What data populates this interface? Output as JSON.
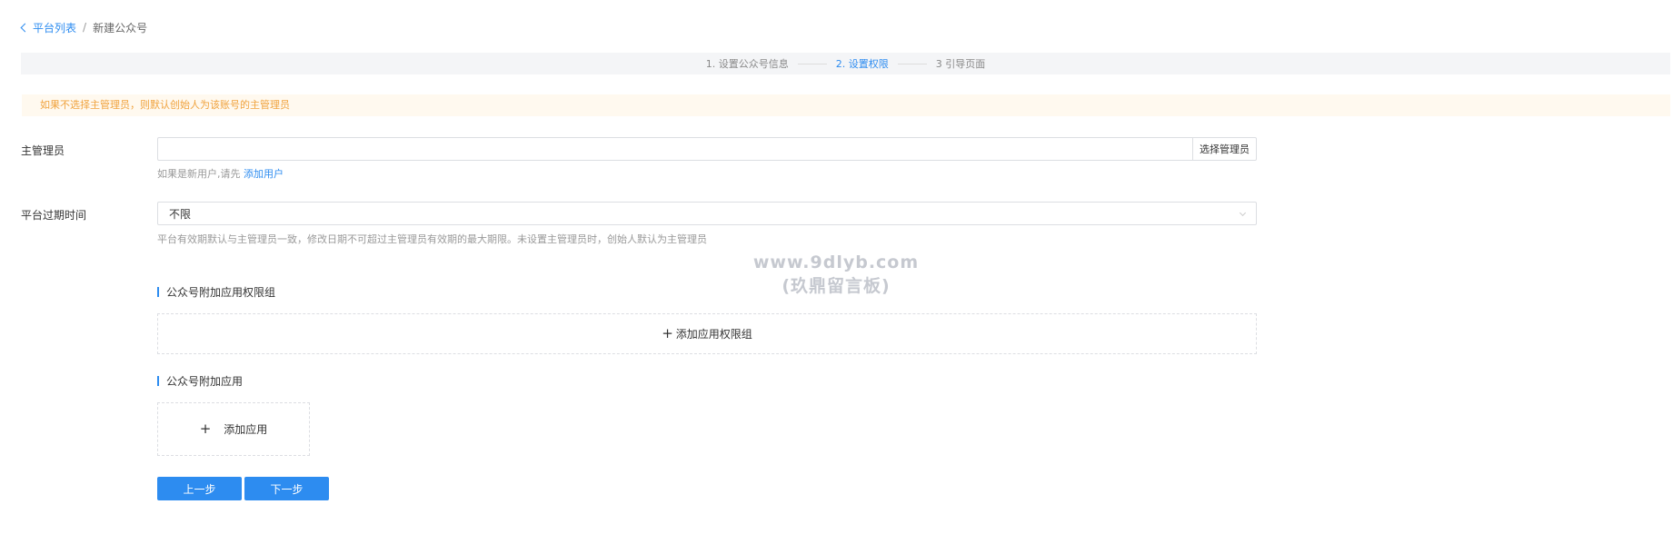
{
  "breadcrumb": {
    "back_label": "平台列表",
    "separator": "/",
    "current": "新建公众号"
  },
  "steps": [
    {
      "label": "1. 设置公众号信息",
      "active": false
    },
    {
      "label": "2. 设置权限",
      "active": true
    },
    {
      "label": "3 引导页面",
      "active": false
    }
  ],
  "notice": {
    "text": "如果不选择主管理员，则默认创始人为该账号的主管理员"
  },
  "admin": {
    "label": "主管理员",
    "value": "",
    "select_button": "选择管理员",
    "hint_prefix": "如果是新用户,请先",
    "hint_link": "添加用户"
  },
  "expiry": {
    "label": "平台过期时间",
    "selected": "不限",
    "hint": "平台有效期默认与主管理员一致，修改日期不可超过主管理员有效期的最大期限。未设置主管理员时，创始人默认为主管理员"
  },
  "app_groups": {
    "title": "公众号附加应用权限组",
    "add_label": "添加应用权限组"
  },
  "apps": {
    "title": "公众号附加应用",
    "add_label": "添加应用"
  },
  "actions": {
    "prev": "上一步",
    "next": "下一步"
  },
  "watermark": {
    "line1": "www.9dlyb.com",
    "line2": "(玖鼎留言板)"
  },
  "colors": {
    "primary": "#2d8cf0",
    "notice_text": "#f0a33e",
    "notice_bg": "#fff9ef",
    "steps_bg": "#f4f5f7"
  }
}
